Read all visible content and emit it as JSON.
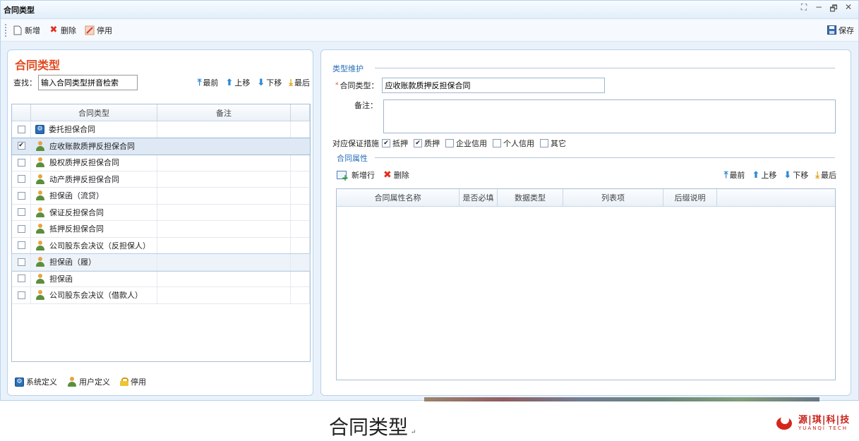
{
  "window": {
    "title": "合同类型"
  },
  "window_controls": [
    "⛶",
    "−",
    "🗗",
    "✕"
  ],
  "toolbar": {
    "new_label": "新增",
    "delete_label": "删除",
    "disable_label": "停用",
    "save_label": "保存"
  },
  "left": {
    "title": "合同类型",
    "search_label": "查找：",
    "search_value": "输入合同类型拼音检索",
    "move": {
      "first": "最前",
      "up": "上移",
      "down": "下移",
      "last": "最后"
    },
    "columns": [
      "合同类型",
      "备注"
    ],
    "rows": [
      {
        "name": "委托担保合同",
        "note": "",
        "checked": false,
        "icon": "system-icon"
      },
      {
        "name": "应收账款质押反担保合同",
        "note": "",
        "checked": true,
        "icon": "user-icon",
        "state": "selected"
      },
      {
        "name": "股权质押反担保合同",
        "note": "",
        "checked": false,
        "icon": "user-icon"
      },
      {
        "name": "动产质押反担保合同",
        "note": "",
        "checked": false,
        "icon": "user-icon"
      },
      {
        "name": "担保函（流贷）",
        "note": "",
        "checked": false,
        "icon": "user-icon"
      },
      {
        "name": "保证反担保合同",
        "note": "",
        "checked": false,
        "icon": "user-icon"
      },
      {
        "name": "抵押反担保合同",
        "note": "",
        "checked": false,
        "icon": "user-icon"
      },
      {
        "name": "公司股东会决议（反担保人）",
        "note": "",
        "checked": false,
        "icon": "user-icon"
      },
      {
        "name": "担保函（履）",
        "note": "",
        "checked": false,
        "icon": "user-icon",
        "state": "hover"
      },
      {
        "name": "担保函",
        "note": "",
        "checked": false,
        "icon": "user-icon"
      },
      {
        "name": "公司股东会决议（借款人）",
        "note": "",
        "checked": false,
        "icon": "user-icon"
      }
    ],
    "legend": {
      "system": "系统定义",
      "user": "用户定义",
      "disabled": "停用"
    }
  },
  "right": {
    "section_type": "类型维护",
    "type_label": "合同类型：",
    "type_value": "应收账款质押反担保合同",
    "note_label": "备注：",
    "note_value": "",
    "measures_label": "对应保证措施",
    "measures": [
      {
        "label": "抵押",
        "checked": true
      },
      {
        "label": "质押",
        "checked": true
      },
      {
        "label": "企业信用",
        "checked": false
      },
      {
        "label": "个人信用",
        "checked": false
      },
      {
        "label": "其它",
        "checked": false
      }
    ],
    "section_attr": "合同属性",
    "add_row_label": "新增行",
    "delete_label": "删除",
    "move": {
      "first": "最前",
      "up": "上移",
      "down": "下移",
      "last": "最后"
    },
    "columns": [
      "合同属性名称",
      "是否必填",
      "数据类型",
      "列表项",
      "后缀说明"
    ]
  },
  "caption": "合同类型",
  "caption_mark": "↵",
  "logo": {
    "cn": "源|琪|科|技",
    "en": "YUANQI TECH"
  },
  "colors": {
    "accent_title": "#e04a1f",
    "section_blue": "#2a6fb8",
    "delete_red": "#e0301e"
  }
}
